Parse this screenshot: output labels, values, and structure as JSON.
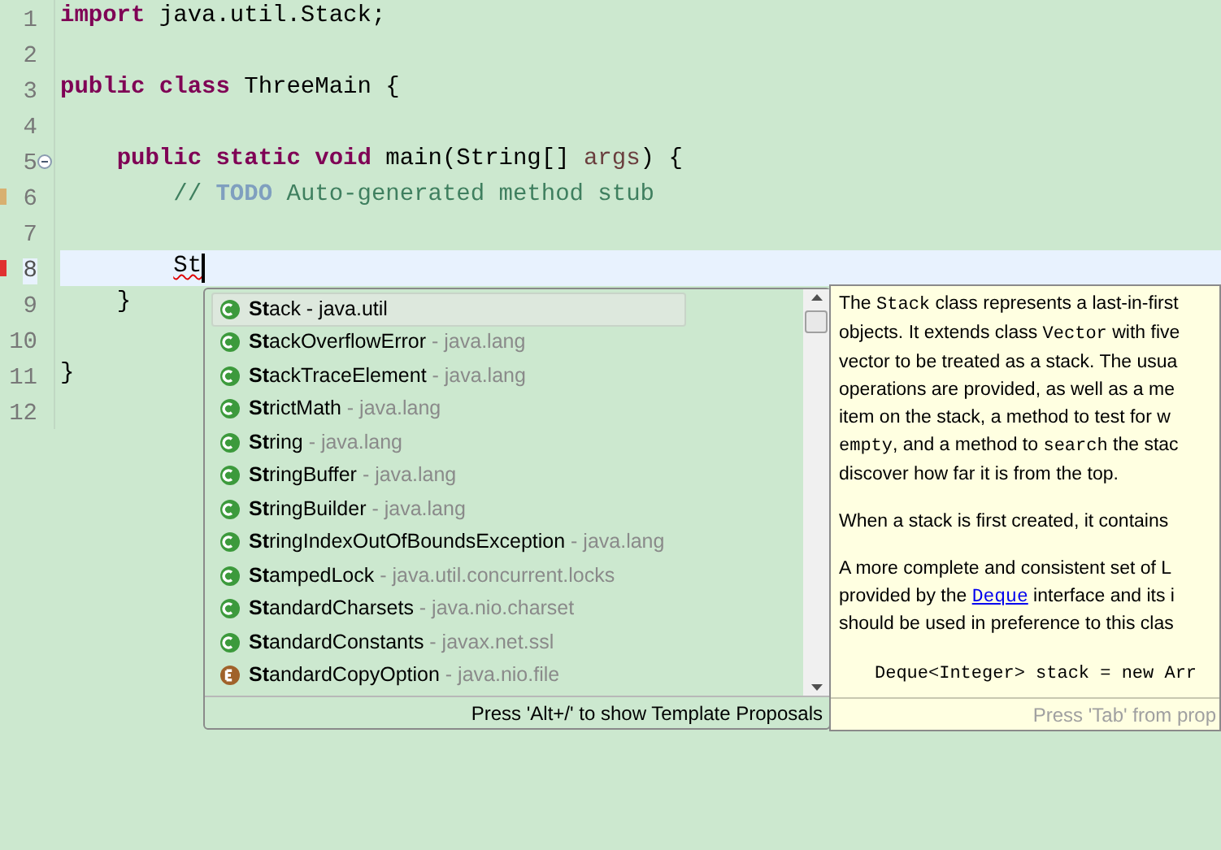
{
  "editor": {
    "lines": [
      {
        "number": "1",
        "current": false,
        "collapsible": false,
        "has_task": false,
        "has_error": false,
        "tokens": [
          {
            "text": "import",
            "kind": "keyword"
          },
          {
            "text": " java.util.Stack;",
            "kind": "plain"
          }
        ]
      },
      {
        "number": "2",
        "current": false,
        "collapsible": false,
        "has_task": false,
        "has_error": false
      },
      {
        "number": "3",
        "current": false,
        "collapsible": false,
        "has_task": false,
        "has_error": false,
        "tokens": [
          {
            "text": "public class",
            "kind": "keyword"
          },
          {
            "text": " ThreeMain {",
            "kind": "plain"
          }
        ]
      },
      {
        "number": "4",
        "current": false,
        "collapsible": false,
        "has_task": false,
        "has_error": false
      },
      {
        "number": "5",
        "current": false,
        "collapsible": true,
        "has_task": false,
        "has_error": false,
        "tokens": [
          {
            "text": "    public static void",
            "kind": "keyword"
          },
          {
            "text": " main(String[] ",
            "kind": "plain"
          },
          {
            "text": "args",
            "kind": "param"
          },
          {
            "text": ") {",
            "kind": "plain"
          }
        ]
      },
      {
        "number": "6",
        "current": false,
        "collapsible": false,
        "has_task": true,
        "has_error": false,
        "tokens": [
          {
            "text": "        // ",
            "kind": "comment"
          },
          {
            "text": "TODO",
            "kind": "todo"
          },
          {
            "text": " Auto-generated method stub",
            "kind": "comment"
          }
        ]
      },
      {
        "number": "7",
        "current": false,
        "collapsible": false,
        "has_task": false,
        "has_error": false
      },
      {
        "number": "8",
        "current": true,
        "collapsible": false,
        "has_task": false,
        "has_error": true,
        "tokens": [
          {
            "text": "        St",
            "kind": "error"
          }
        ]
      },
      {
        "number": "9",
        "current": false,
        "collapsible": false,
        "has_task": false,
        "has_error": false,
        "tokens": [
          {
            "text": "    }",
            "kind": "plain"
          }
        ]
      },
      {
        "number": "10",
        "current": false,
        "collapsible": false,
        "has_task": false,
        "has_error": false
      },
      {
        "number": "11",
        "current": false,
        "collapsible": false,
        "has_task": false,
        "has_error": false,
        "tokens": [
          {
            "text": "}",
            "kind": "plain"
          }
        ]
      },
      {
        "number": "12",
        "current": false,
        "collapsible": false,
        "has_task": false,
        "has_error": false
      }
    ]
  },
  "proposals": {
    "items": [
      {
        "name": "**St**ack",
        "package": " - java.util",
        "kind": "class",
        "selected": true
      },
      {
        "name": "**St**ackOverflowError",
        "package": " - java.lang",
        "kind": "class",
        "selected": false
      },
      {
        "name": "**St**ackTraceElement",
        "package": " - java.lang",
        "kind": "class",
        "selected": false
      },
      {
        "name": "**St**rictMath",
        "package": " - java.lang",
        "kind": "class",
        "selected": false
      },
      {
        "name": "**St**ring",
        "package": " - java.lang",
        "kind": "class",
        "selected": false
      },
      {
        "name": "**St**ringBuffer",
        "package": " - java.lang",
        "kind": "class",
        "selected": false
      },
      {
        "name": "**St**ringBuilder",
        "package": " - java.lang",
        "kind": "class",
        "selected": false
      },
      {
        "name": "**St**ringIndexOutOfBoundsException",
        "package": " - java.lang",
        "kind": "class",
        "selected": false
      },
      {
        "name": "**St**ampedLock",
        "package": " - java.util.concurrent.locks",
        "kind": "class",
        "selected": false
      },
      {
        "name": "**St**andardCharsets",
        "package": " - java.nio.charset",
        "kind": "class",
        "selected": false
      },
      {
        "name": "**St**andardConstants",
        "package": " - javax.net.ssl",
        "kind": "class",
        "selected": false
      },
      {
        "name": "**St**andardCopyOption",
        "package": " - java.nio.file",
        "kind": "enum",
        "selected": false
      }
    ],
    "footer": "Press 'Alt+/' to show Template Proposals"
  },
  "documentation": {
    "paragraphs": [
      [
        [
          {
            "text": "The ",
            "kind": "text"
          },
          {
            "text": "Stack",
            "kind": "code"
          },
          {
            "text": " class represents a last-in-first",
            "kind": "text"
          }
        ],
        [
          {
            "text": "objects. It extends class ",
            "kind": "text"
          },
          {
            "text": "Vector",
            "kind": "code"
          },
          {
            "text": " with five",
            "kind": "text"
          }
        ],
        [
          {
            "text": "vector to be treated as a stack. The usua",
            "kind": "text"
          }
        ],
        [
          {
            "text": "operations are provided, as well as a me",
            "kind": "text"
          }
        ],
        [
          {
            "text": "item on the stack, a method to test for w",
            "kind": "text"
          }
        ],
        [
          {
            "text": "empty",
            "kind": "code"
          },
          {
            "text": ", and a method to ",
            "kind": "text"
          },
          {
            "text": "search",
            "kind": "code"
          },
          {
            "text": " the stac",
            "kind": "text"
          }
        ],
        [
          {
            "text": "discover how far it is from the top.",
            "kind": "text"
          }
        ]
      ],
      [
        [
          {
            "text": "When a stack is first created, it contains",
            "kind": "text"
          }
        ]
      ],
      [
        [
          {
            "text": "A more complete and consistent set of L",
            "kind": "text"
          }
        ],
        [
          {
            "text": "provided by the ",
            "kind": "text"
          },
          {
            "text": "Deque",
            "kind": "link"
          },
          {
            "text": " interface and its i",
            "kind": "text"
          }
        ],
        [
          {
            "text": "should be used in preference to this clas",
            "kind": "text"
          }
        ]
      ]
    ],
    "code_line": "Deque<Integer> stack = new Arr",
    "footer": "Press 'Tab' from prop"
  }
}
